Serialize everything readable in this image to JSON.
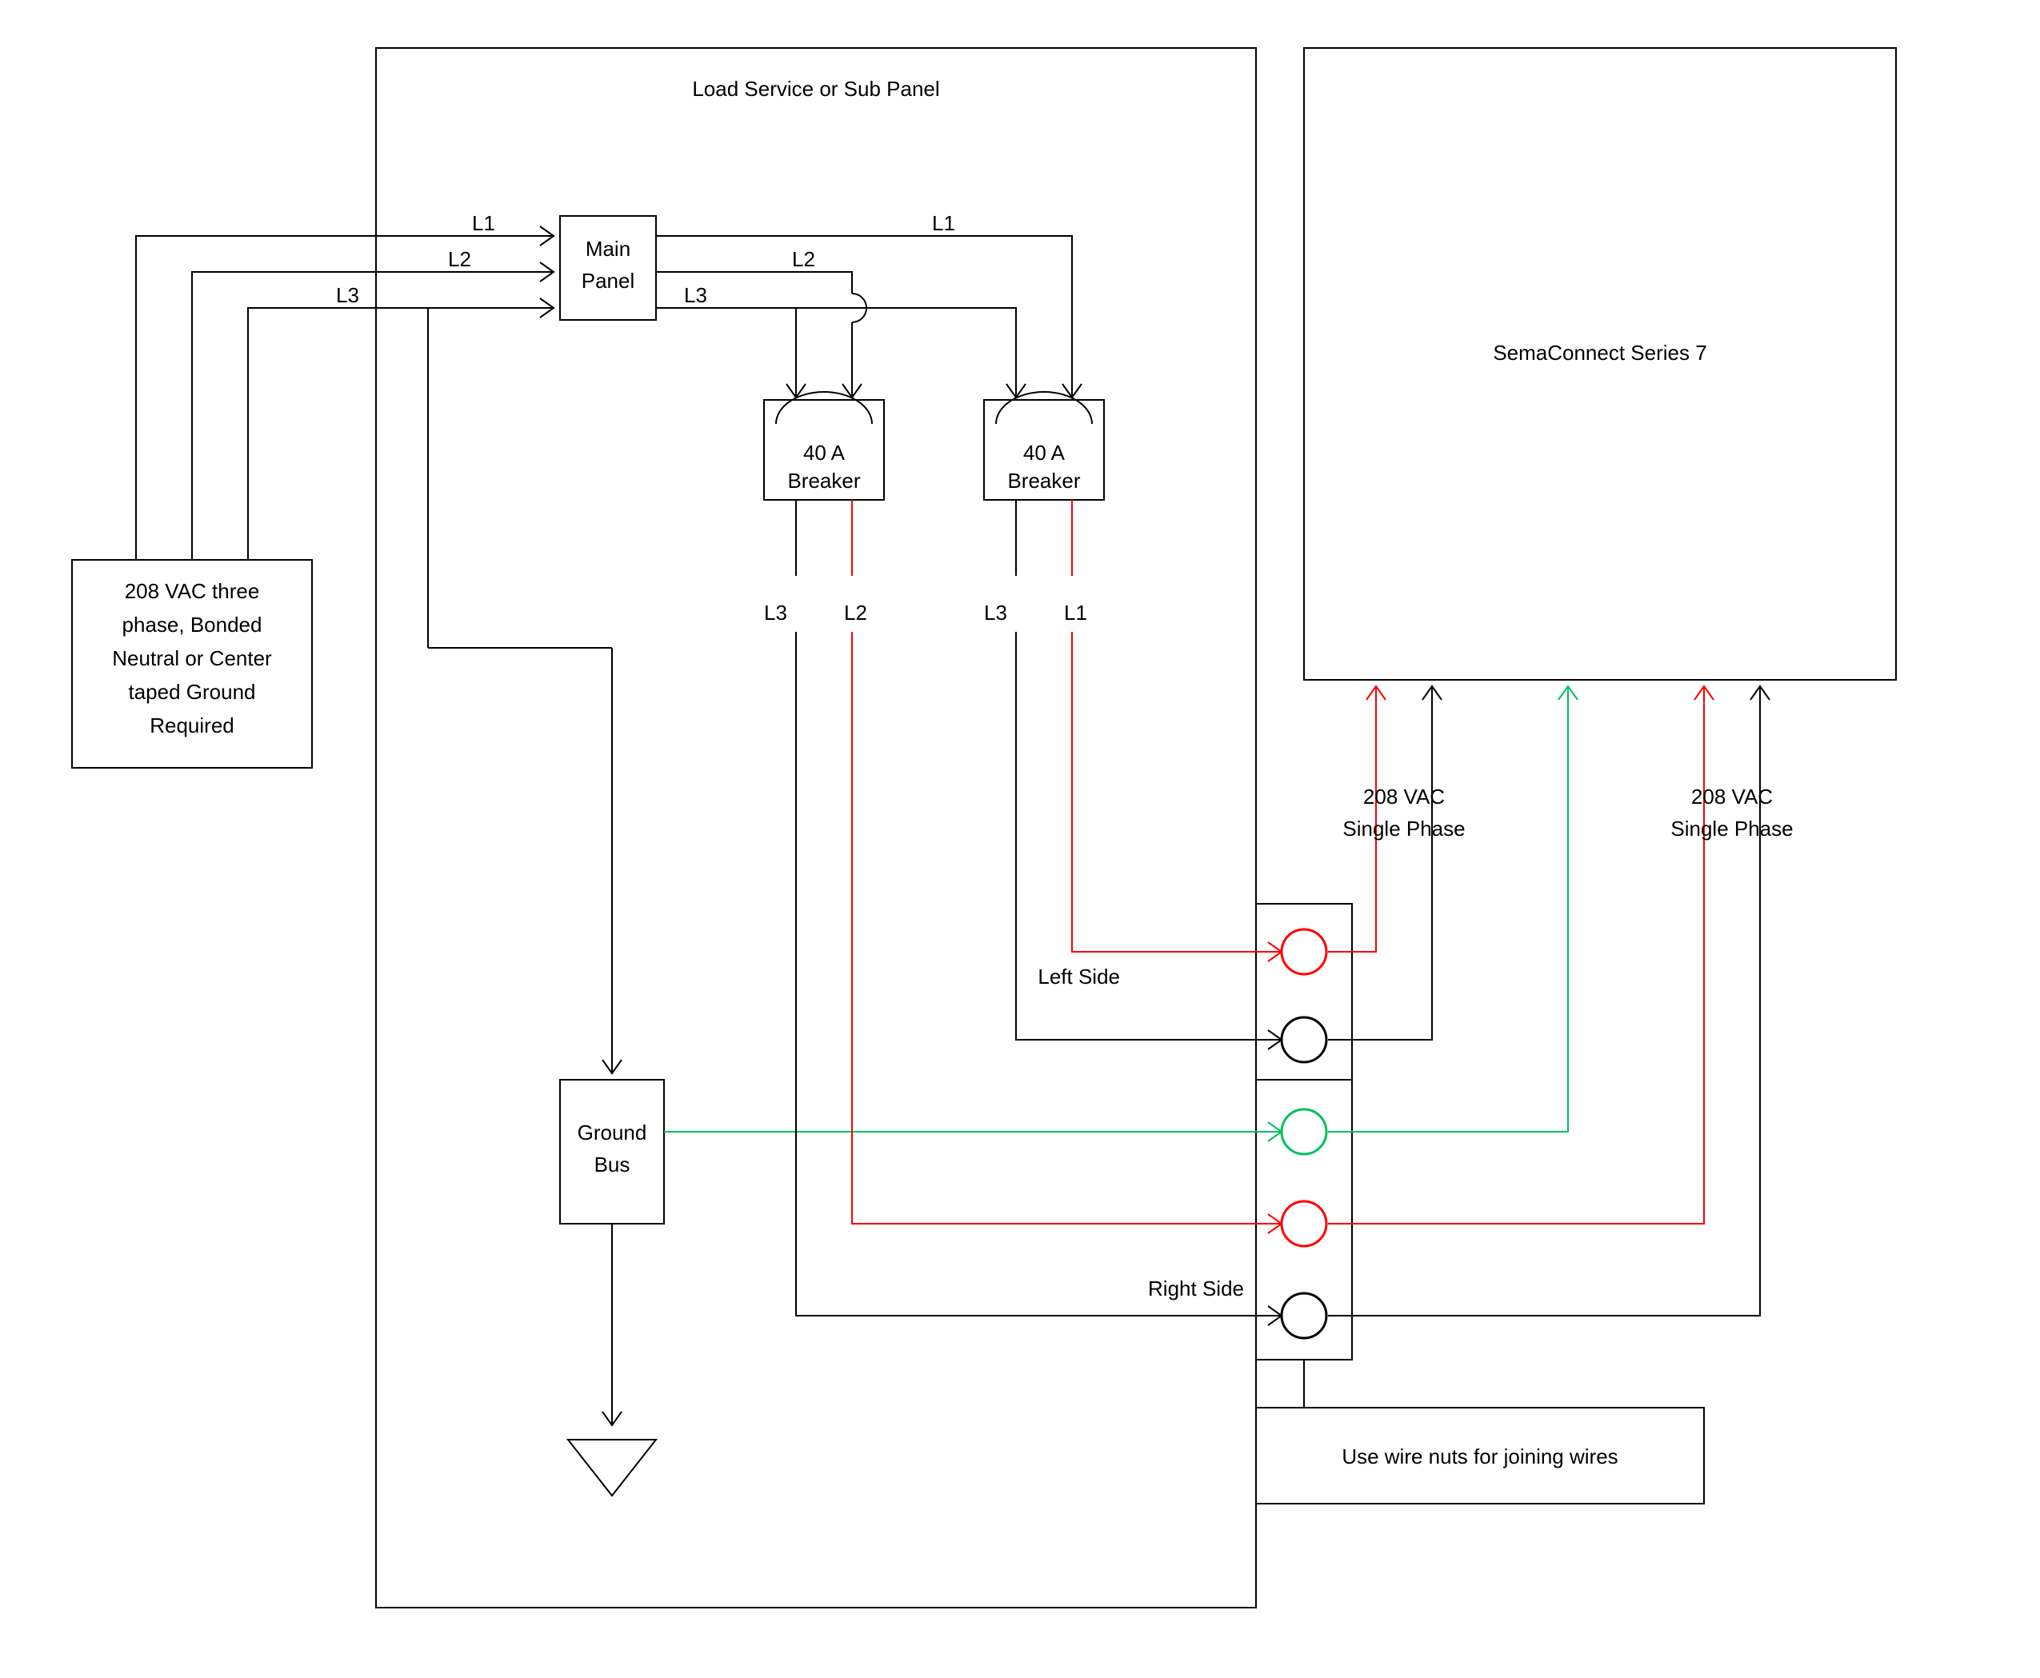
{
  "diagram": {
    "outer_panel_title": "Load Service or Sub Panel",
    "source_box": {
      "line1": "208 VAC three",
      "line2": "phase, Bonded",
      "line3": "Neutral or Center",
      "line4": "taped Ground",
      "line5": "Required"
    },
    "main_panel": {
      "line1": "Main",
      "line2": "Panel"
    },
    "phase_labels": {
      "L1": "L1",
      "L2": "L2",
      "L3": "L3"
    },
    "breaker_left": {
      "line1": "40 A",
      "line2": "Breaker"
    },
    "breaker_right": {
      "line1": "40 A",
      "line2": "Breaker"
    },
    "breaker_out_labels": {
      "left_L3": "L3",
      "left_L2": "L2",
      "right_L3": "L3",
      "right_L1": "L1"
    },
    "ground_bus": {
      "line1": "Ground",
      "line2": "Bus"
    },
    "terminal_block": {
      "left_side": "Left Side",
      "right_side": "Right Side"
    },
    "wire_nuts_note": "Use wire nuts for joining wires",
    "device_box": "SemaConnect Series 7",
    "device_inputs": {
      "left": {
        "line1": "208 VAC",
        "line2": "Single Phase"
      },
      "right": {
        "line1": "208 VAC",
        "line2": "Single Phase"
      }
    }
  },
  "colors": {
    "red": "#ff0000",
    "green": "#00c060",
    "black": "#000000"
  }
}
